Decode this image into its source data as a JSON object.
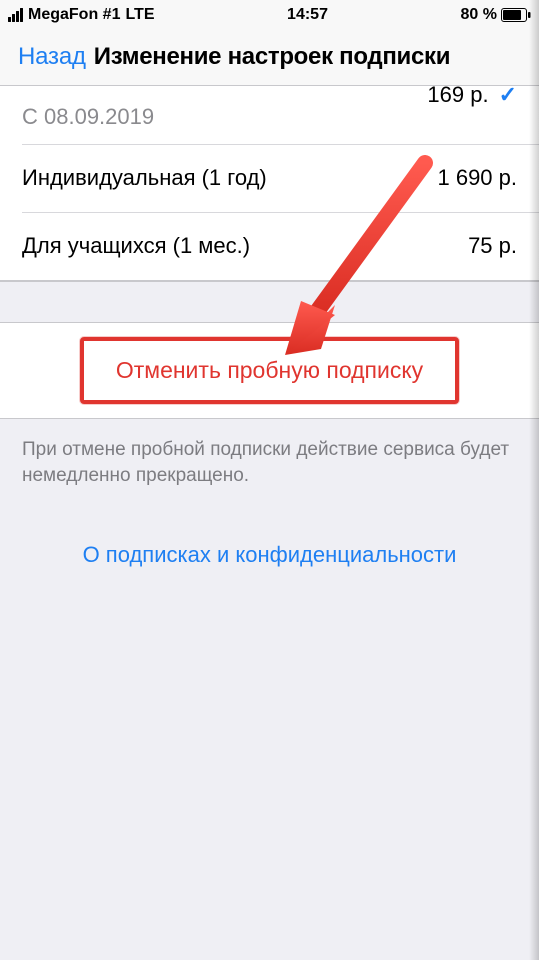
{
  "status_bar": {
    "carrier": "MegaFon #1",
    "network": "LTE",
    "time": "14:57",
    "battery_pct": "80 %"
  },
  "nav": {
    "back_label": "Назад",
    "title": "Изменение настроек подписки"
  },
  "plans": {
    "current": {
      "from_label": "С 08.09.2019",
      "price": "169 р."
    },
    "individual_year": {
      "label": "Индивидуальная (1 год)",
      "price": "1 690 р."
    },
    "student_month": {
      "label": "Для учащихся (1 мес.)",
      "price": "75 р."
    }
  },
  "cancel": {
    "label": "Отменить пробную подписку"
  },
  "footer": {
    "note": "При отмене пробной подписки действие сервиса будет немедленно прекращено.",
    "link": "О подписках и конфиденциальности"
  }
}
